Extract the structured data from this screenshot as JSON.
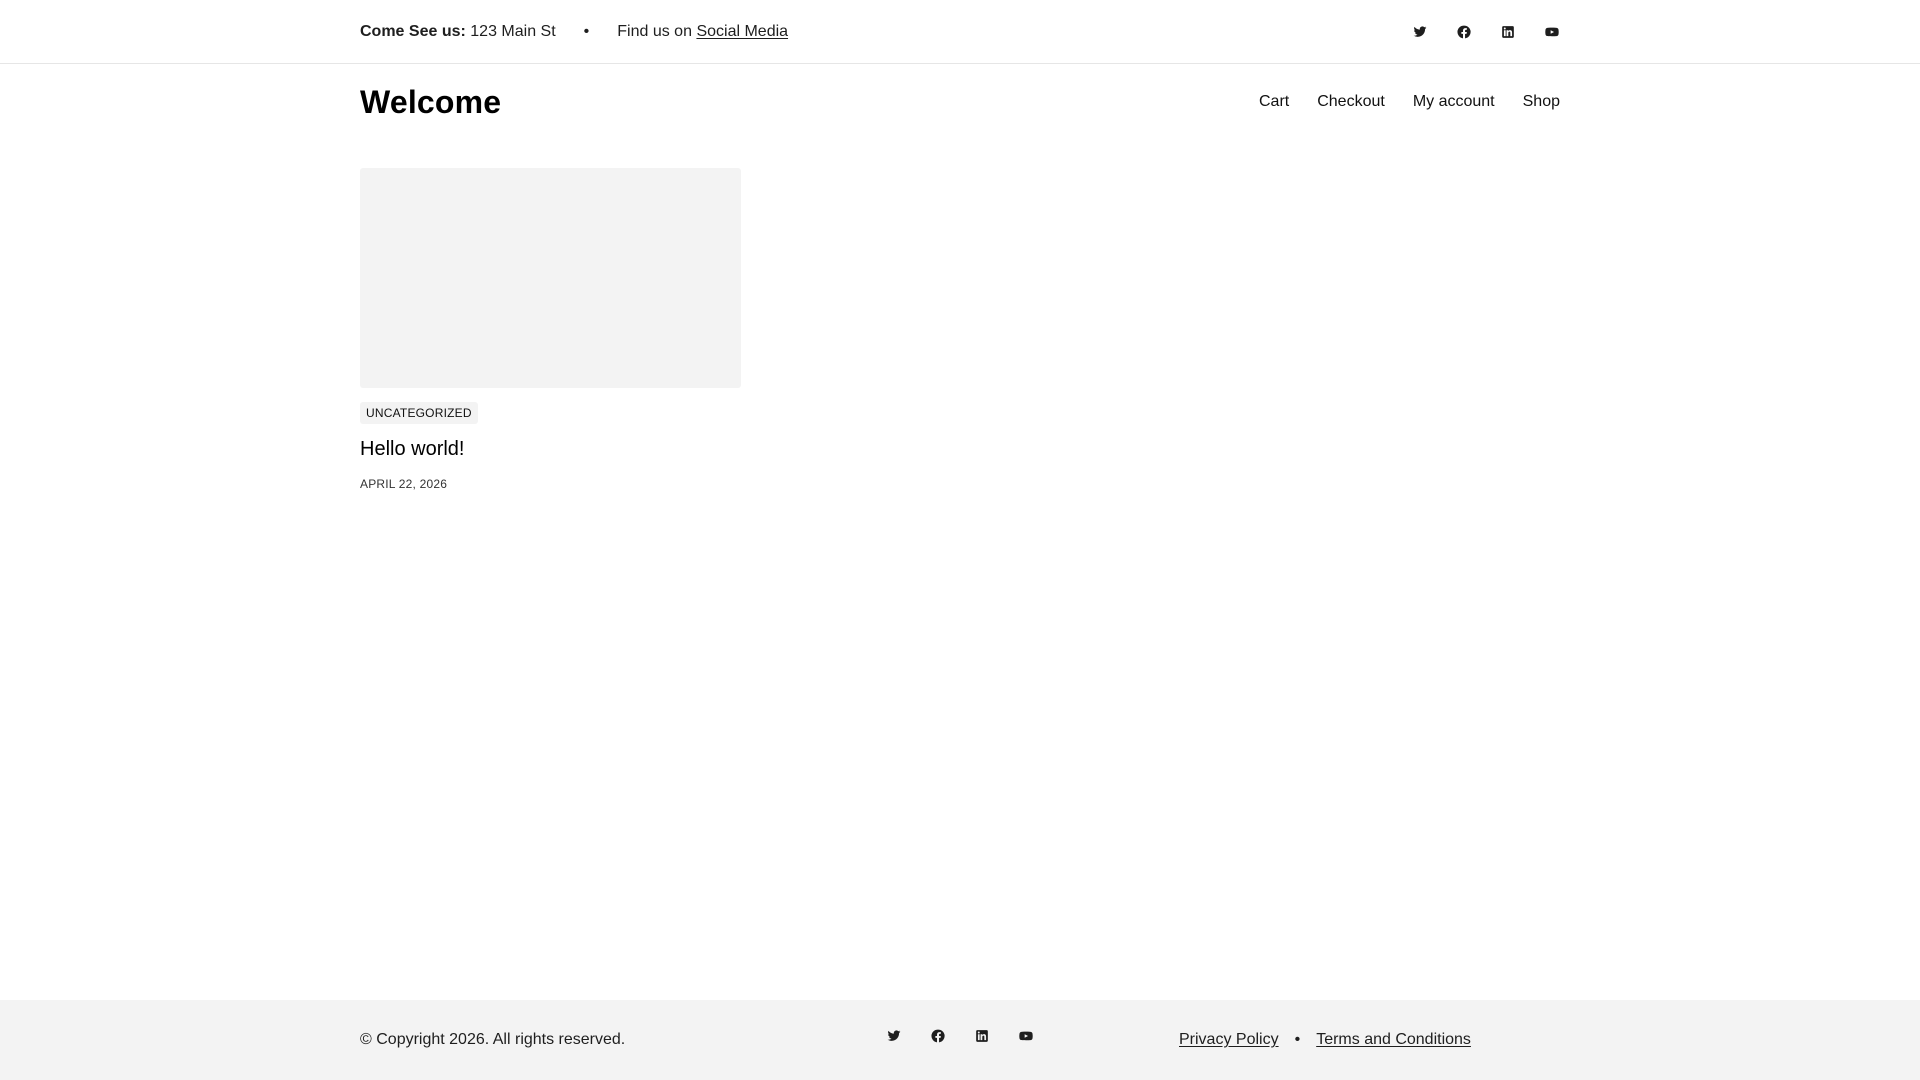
{
  "topbar": {
    "address_label": "Come See us:",
    "address_value": "123 Main St",
    "separator": "•",
    "find_us_text": "Find us on",
    "social_link": "Social Media",
    "social_icons": [
      "twitter-icon",
      "facebook-icon",
      "linkedin-icon",
      "youtube-icon"
    ]
  },
  "header": {
    "site_title": "Welcome",
    "nav": [
      "Cart",
      "Checkout",
      "My account",
      "Shop"
    ]
  },
  "post": {
    "category": "UNCATEGORIZED",
    "title": "Hello world!",
    "date": "APRIL 22, 2026"
  },
  "footer": {
    "copyright": "© Copyright 2026. All rights reserved.",
    "separator": "•",
    "links": [
      "Privacy Policy",
      "Terms and Conditions"
    ]
  },
  "colors": {
    "text": "#1e1e1e",
    "muted_background": "#f3f3f3",
    "border": "#e6e6e6"
  }
}
